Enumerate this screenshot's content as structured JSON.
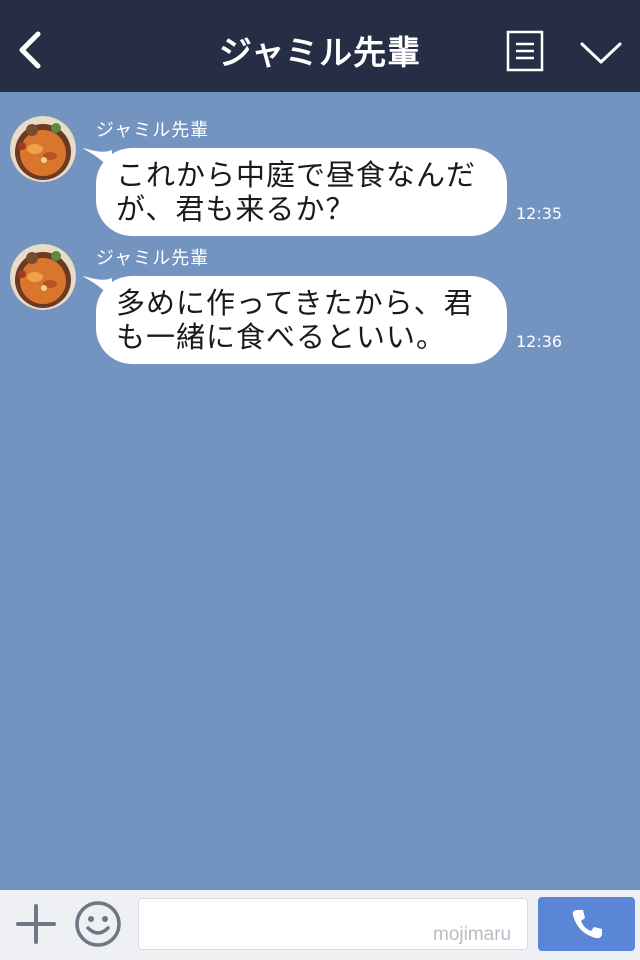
{
  "header": {
    "title": "ジャミル先輩",
    "back_icon": "chevron-left-icon",
    "notes_icon": "notes-icon",
    "collapse_icon": "chevron-down-icon"
  },
  "messages": [
    {
      "sender": "ジャミル先輩",
      "text_lines": [
        "これから中庭で昼食なんだ",
        "が、君も来るか？"
      ],
      "time": "12:35"
    },
    {
      "sender": "ジャミル先輩",
      "text_lines": [
        "多めに作ってきたから、君",
        "も一緒に食べるといい。"
      ],
      "time": "12:36"
    }
  ],
  "composer": {
    "input_value": "",
    "watermark": "mojimaru",
    "plus_icon": "plus-icon",
    "emoji_icon": "smiley-icon",
    "call_icon": "phone-icon"
  },
  "colors": {
    "header_bg": "#252e44",
    "chat_bg": "#7393c1",
    "bubble_bg": "#ffffff",
    "call_button": "#5b86d8"
  }
}
